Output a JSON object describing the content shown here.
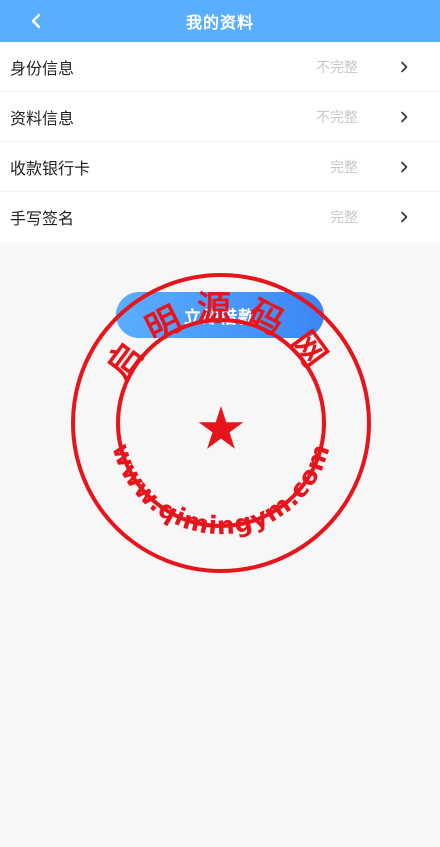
{
  "header": {
    "title": "我的资料",
    "back_icon": "chevron-left-icon"
  },
  "items": [
    {
      "label": "身份信息",
      "status": "不完整"
    },
    {
      "label": "资料信息",
      "status": "不完整"
    },
    {
      "label": "收款银行卡",
      "status": "完整"
    },
    {
      "label": "手写签名",
      "status": "完整"
    }
  ],
  "apply_button": {
    "label": "立即借款"
  },
  "watermark": {
    "top_text": "启明源码网",
    "bottom_text": "www.qimingym.com"
  },
  "colors": {
    "header_bg": "#5aaeff",
    "button_start": "#5aaeff",
    "button_end": "#3b86f6",
    "stamp_red": "#e8141c",
    "status_gray": "#c8c8c8"
  }
}
